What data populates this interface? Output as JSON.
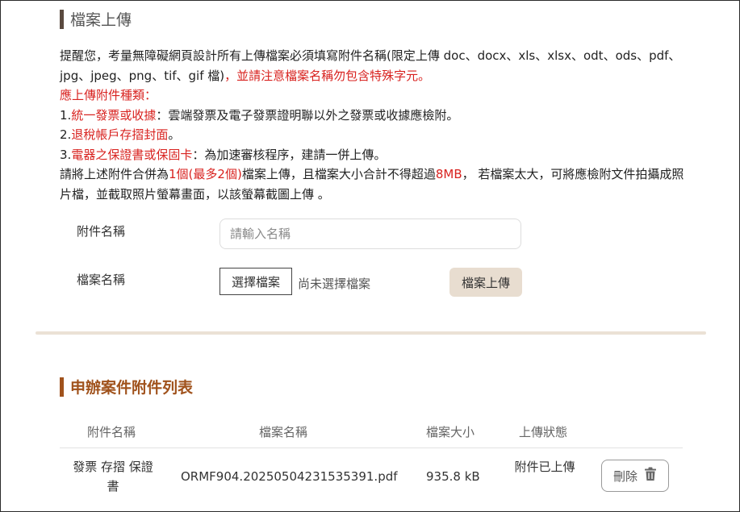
{
  "upload_section": {
    "title": "檔案上傳",
    "notice": {
      "line1_text": "提醒您，考量無障礙網頁設計所有上傳檔案必須填寫附件名稱(限定上傳 doc、docx、xls、xlsx、odt、ods、pdf、jpg、jpeg、png、tif、gif 檔)",
      "line1_red": "，並請注意檔案名稱勿包含特殊字元。",
      "types_heading": "應上傳附件種類：",
      "item1_num": "1.",
      "item1_red": "統一發票或收據",
      "item1_text": "：雲端發票及電子發票證明聯以外之發票或收據應檢附。",
      "item2_num": "2.",
      "item2_red": "退稅帳戶存摺封面",
      "item2_end": "。",
      "item3_num": "3.",
      "item3_red": "電器之保證書或保固卡",
      "item3_text": "：為加速審核程序，建請一併上傳。",
      "merge_text1": "請將上述附件合併為",
      "merge_red1": "1個(最多2個)",
      "merge_text2": "檔案上傳，且檔案大小合計不得超過",
      "merge_red2": "8MB",
      "merge_text3": "， 若檔案太大，可將應檢附文件拍攝成照片檔，並截取照片螢幕畫面，以該螢幕截圖上傳 。"
    },
    "attachment_name_label": "附件名稱",
    "attachment_name_placeholder": "請輸入名稱",
    "file_name_label": "檔案名稱",
    "choose_file_button": "選擇檔案",
    "no_file_selected": "尚未選擇檔案",
    "upload_button": "檔案上傳"
  },
  "list_section": {
    "title": "申辦案件附件列表",
    "columns": [
      "附件名稱",
      "檔案名稱",
      "檔案大小",
      "上傳狀態"
    ],
    "rows": [
      {
        "attachment_name": "發票 存摺 保證書",
        "file_name": "ORMF904.20250504231535391.pdf",
        "file_size": "935.8 kB",
        "status": "附件已上傳",
        "delete_label": "刪除",
        "delete_icon": "trash-icon"
      }
    ]
  },
  "colors": {
    "accent_brown": "#a0521c",
    "alert_red": "#d8221f",
    "upload_button_bg": "#e8ddd0"
  }
}
